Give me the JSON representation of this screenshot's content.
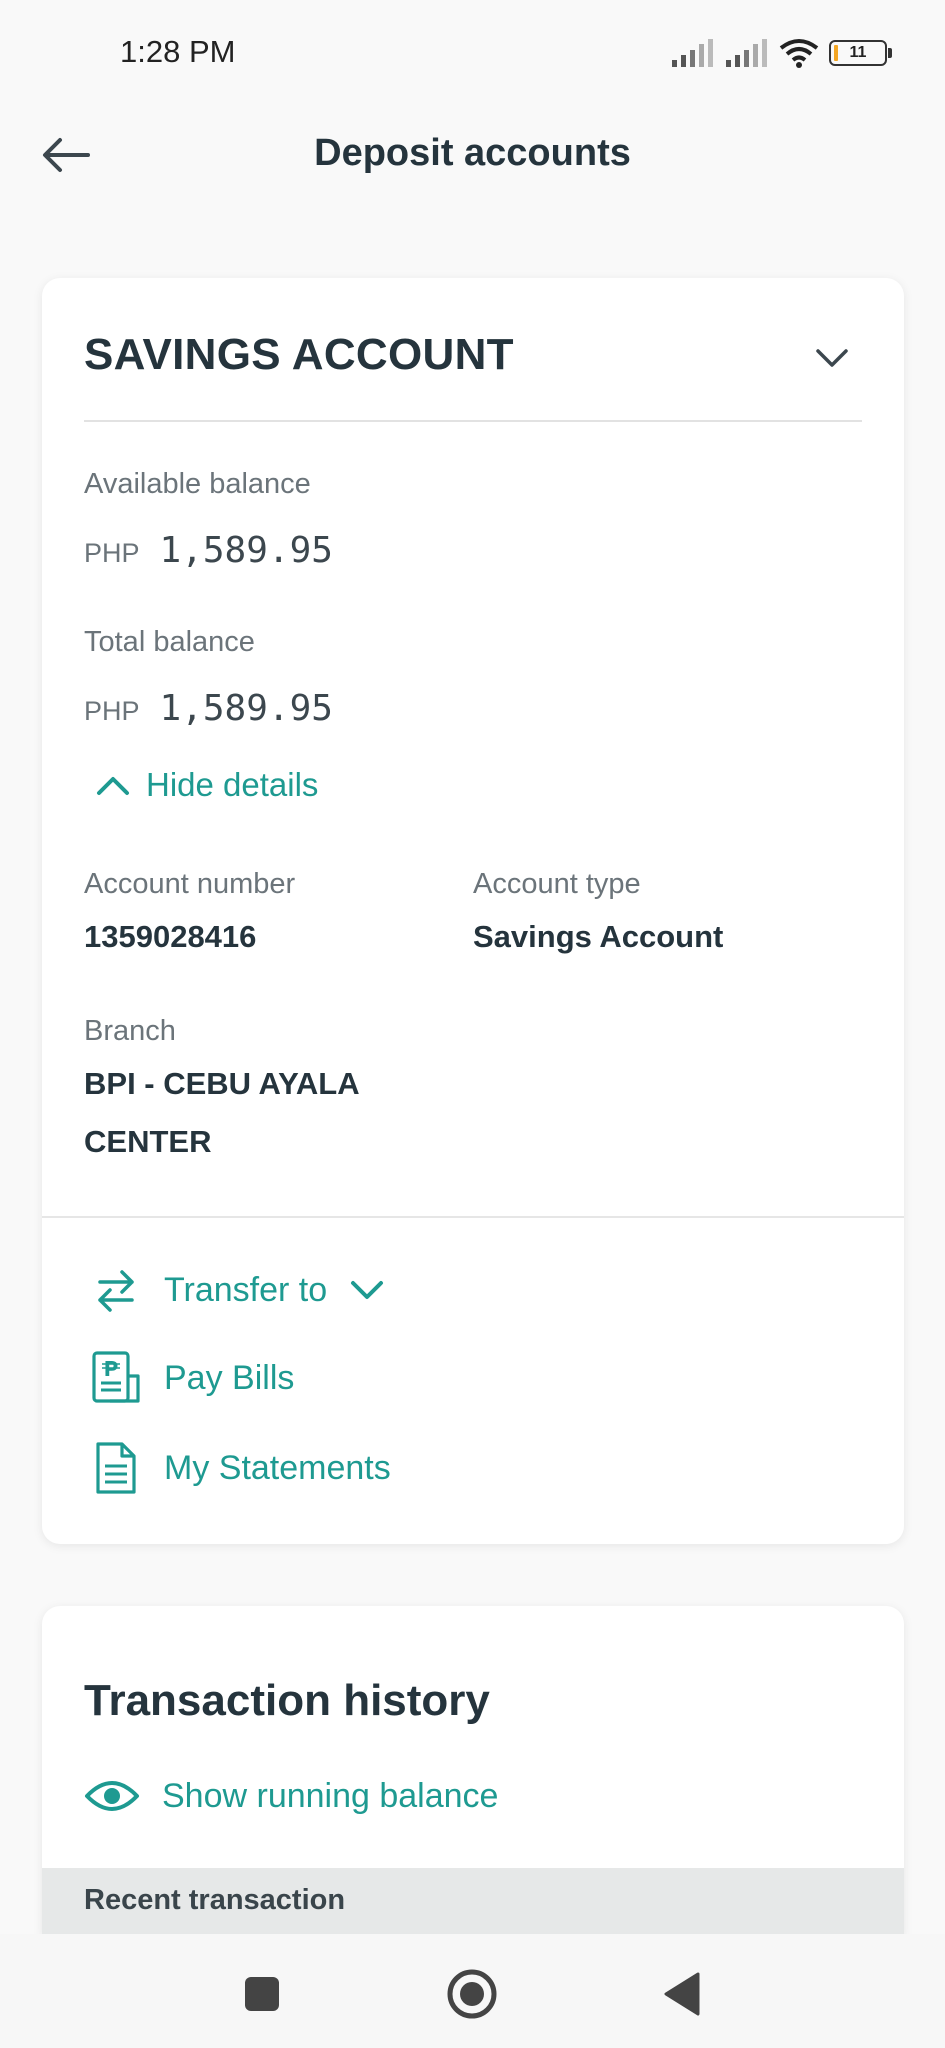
{
  "status_bar": {
    "time": "1:28 PM",
    "battery": "11",
    "icons": [
      "signal-icon",
      "signal-icon",
      "wifi-icon",
      "battery-icon"
    ]
  },
  "header": {
    "title": "Deposit accounts",
    "back_icon": "arrow-left-icon"
  },
  "account_card": {
    "title": "SAVINGS ACCOUNT",
    "available_label": "Available balance",
    "available_currency": "PHP",
    "available_amount": "1,589.95",
    "total_label": "Total balance",
    "total_currency": "PHP",
    "total_amount": "1,589.95",
    "hide_details": "Hide details",
    "account_number_label": "Account number",
    "account_number": "1359028416",
    "account_type_label": "Account type",
    "account_type": "Savings Account",
    "branch_label": "Branch",
    "branch_line1": "BPI - CEBU AYALA",
    "branch_line2": "CENTER",
    "actions": [
      {
        "label": "Transfer to",
        "icon": "transfer-icon"
      },
      {
        "label": "Pay Bills",
        "icon": "bill-icon"
      },
      {
        "label": "My Statements",
        "icon": "document-icon"
      }
    ]
  },
  "history_card": {
    "title": "Transaction history",
    "running_balance": "Show running balance",
    "recent_label": "Recent transaction"
  },
  "colors": {
    "accent": "#1e9a91",
    "text_dark": "#25343d",
    "text_muted": "#6b747a"
  }
}
